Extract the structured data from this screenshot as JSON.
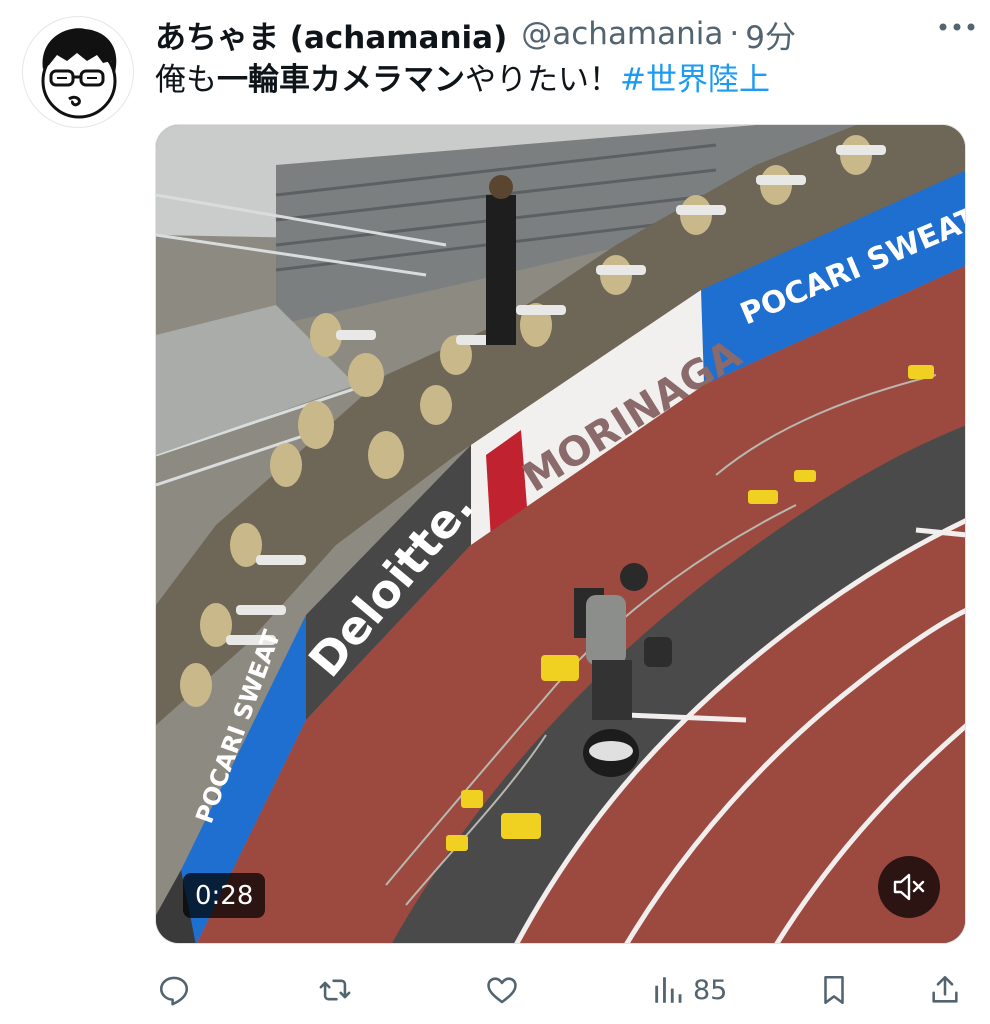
{
  "tweet": {
    "author": {
      "display_name": "あちゃま (achamania)",
      "handle": "@achamania",
      "separator": "·",
      "time": "9分"
    },
    "text": {
      "part1": "俺も",
      "part2_bold": "一輪車カメラマン",
      "part3": "やりたい！",
      "hashtag": "#世界陸上"
    },
    "media": {
      "type": "video",
      "duration": "0:28",
      "muted": true,
      "ad_boards": [
        "POCARI SWEAT",
        "MORINAGA",
        "Deloitte.",
        "POCARI SWEAT"
      ]
    },
    "actions": {
      "reply_count": "",
      "retweet_count": "",
      "like_count": "",
      "views_count": "85"
    }
  },
  "colors": {
    "link": "#1d9bf0",
    "secondary_text": "#536471",
    "track": "#9c4a40"
  }
}
